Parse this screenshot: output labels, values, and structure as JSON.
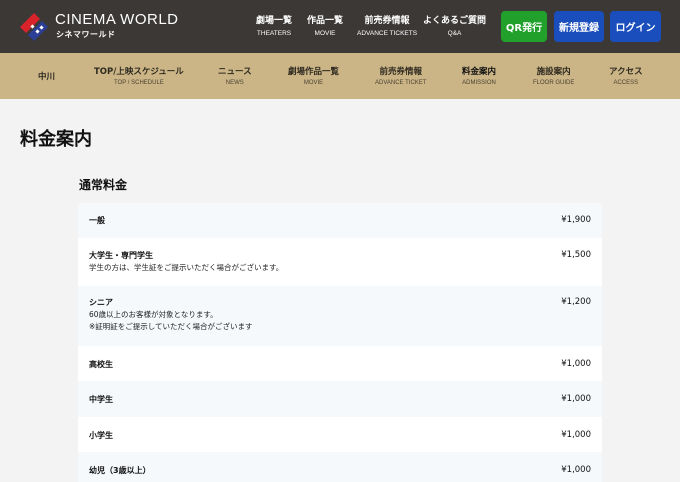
{
  "header": {
    "logo_en": "CINEMA WORLD",
    "logo_jp": "シネマワールド",
    "nav": [
      {
        "jp": "劇場一覧",
        "en": "THEATERS"
      },
      {
        "jp": "作品一覧",
        "en": "MOVIE"
      },
      {
        "jp": "前売券情報",
        "en": "ADVANCE TICKETS"
      },
      {
        "jp": "よくあるご質問",
        "en": "Q&A"
      }
    ],
    "buttons": {
      "qr": "QR発行",
      "register": "新規登録",
      "login": "ログイン"
    }
  },
  "subnav": {
    "branch": "中川",
    "items": [
      {
        "jp": "TOP/上映スケジュール",
        "en": "TOP / SCHEDULE"
      },
      {
        "jp": "ニュース",
        "en": "NEWS"
      },
      {
        "jp": "劇場作品一覧",
        "en": "MOVIE"
      },
      {
        "jp": "前売券情報",
        "en": "ADVANCE TICKET"
      },
      {
        "jp": "料金案内",
        "en": "ADMISSION"
      },
      {
        "jp": "施設案内",
        "en": "FLOOR GUIDE"
      },
      {
        "jp": "アクセス",
        "en": "ACCESS"
      }
    ]
  },
  "main": {
    "page_title": "料金案内",
    "section_title": "通常料金",
    "prices": [
      {
        "name": "一般",
        "price": "¥1,900"
      },
      {
        "name": "大学生・専門学生",
        "note1": "学生の方は、学生証をご提示いただく場合がございます。",
        "price": "¥1,500"
      },
      {
        "name": "シニア",
        "note1": "60歳以上のお客様が対象となります。",
        "note2": "※証明証をご提示していただく場合がございます",
        "price": "¥1,200"
      },
      {
        "name": "高校生",
        "price": "¥1,000"
      },
      {
        "name": "中学生",
        "price": "¥1,000"
      },
      {
        "name": "小学生",
        "price": "¥1,000"
      },
      {
        "name": "幼児（3歳以上）",
        "price": "¥1,000"
      }
    ]
  },
  "colors": {
    "header_bg": "#3b3836",
    "subnav_bg": "#cbb586",
    "qr_button": "#22a02c",
    "account_buttons": "#1a4ebd",
    "logo_red": "#d8232a",
    "logo_blue": "#2a3f95"
  }
}
